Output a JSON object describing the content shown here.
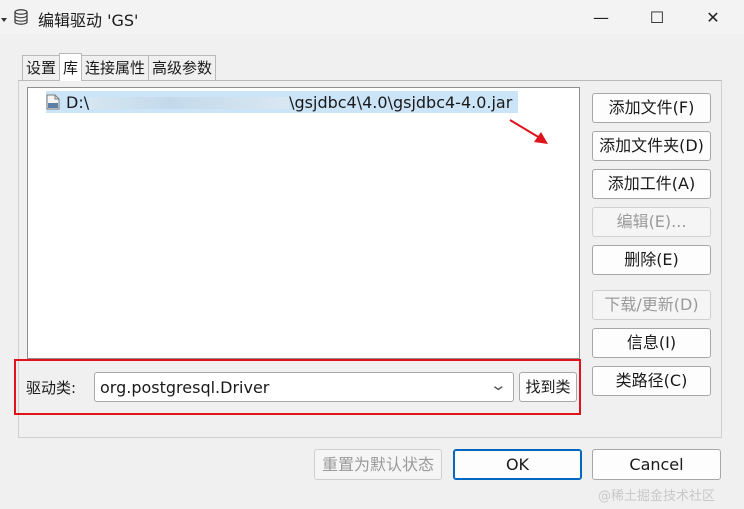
{
  "window": {
    "title": "编辑驱动 'GS'",
    "icon": "database-icon",
    "controls": {
      "minimize": "—",
      "maximize": "☐",
      "close": "✕"
    }
  },
  "tabs": [
    {
      "label": "设置",
      "active": false
    },
    {
      "label": "库",
      "active": true
    },
    {
      "label": "连接属性",
      "active": false
    },
    {
      "label": "高级参数",
      "active": false
    }
  ],
  "library": {
    "files": [
      {
        "icon": "jar-file-icon",
        "path_prefix": "D:\\",
        "path_suffix": "\\gsjdbc4\\4.0\\gsjdbc4-4.0.jar",
        "selected": true
      }
    ]
  },
  "driver": {
    "label": "驱动类:",
    "value": "org.postgresql.Driver",
    "find_button": "找到类"
  },
  "side_buttons": [
    {
      "label": "添加文件(F)",
      "enabled": true
    },
    {
      "label": "添加文件夹(D)",
      "enabled": true
    },
    {
      "label": "添加工件(A)",
      "enabled": true
    },
    {
      "label": "编辑(E)...",
      "enabled": false
    },
    {
      "label": "删除(E)",
      "enabled": true
    },
    {
      "label": "下载/更新(D)",
      "enabled": false
    },
    {
      "label": "信息(I)",
      "enabled": true
    },
    {
      "label": "类路径(C)",
      "enabled": true
    }
  ],
  "bottom_buttons": {
    "reset": "重置为默认状态",
    "ok": "OK",
    "cancel": "Cancel"
  },
  "watermark": "@稀土掘金技术社区",
  "colors": {
    "highlight_box": "#e0131b",
    "selection": "#cce4f7",
    "ok_border": "#0067c0"
  }
}
